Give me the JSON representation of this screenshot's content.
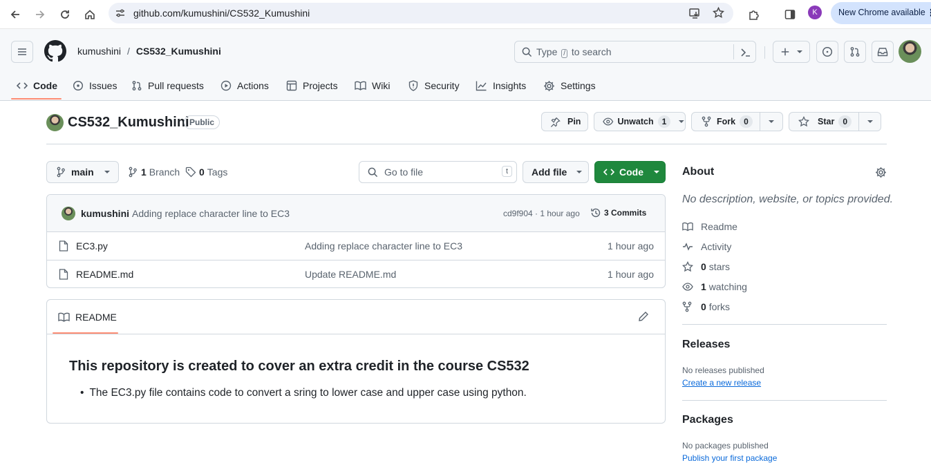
{
  "browser": {
    "url": "github.com/kumushini/CS532_Kumushini",
    "new_chrome_label": "New Chrome available",
    "profile_initial": "K"
  },
  "header": {
    "owner": "kumushini",
    "separator": "/",
    "repo": "CS532_Kumushini",
    "search_prefix": "Type",
    "search_key": "/",
    "search_suffix": "to search"
  },
  "tabs": [
    {
      "label": "Code",
      "icon": "code-icon"
    },
    {
      "label": "Issues",
      "icon": "issue-icon"
    },
    {
      "label": "Pull requests",
      "icon": "pull-request-icon"
    },
    {
      "label": "Actions",
      "icon": "play-icon"
    },
    {
      "label": "Projects",
      "icon": "table-icon"
    },
    {
      "label": "Wiki",
      "icon": "book-icon"
    },
    {
      "label": "Security",
      "icon": "shield-icon"
    },
    {
      "label": "Insights",
      "icon": "graph-icon"
    },
    {
      "label": "Settings",
      "icon": "gear-icon"
    }
  ],
  "repo": {
    "name": "CS532_Kumushini",
    "visibility": "Public",
    "pin_label": "Pin",
    "unwatch_label": "Unwatch",
    "watch_count": "1",
    "fork_label": "Fork",
    "fork_count": "0",
    "star_label": "Star",
    "star_count": "0"
  },
  "toolbar": {
    "branch": "main",
    "branches_count": "1",
    "branches_label": "Branch",
    "tags_count": "0",
    "tags_label": "Tags",
    "goto_placeholder": "Go to file",
    "goto_key": "t",
    "add_file_label": "Add file",
    "code_label": "Code"
  },
  "commit": {
    "author": "kumushini",
    "message": "Adding replace character line to EC3",
    "hash_time": "cd9f904 · 1 hour ago",
    "commits_label": "3 Commits"
  },
  "files": [
    {
      "name": "EC3.py",
      "message": "Adding replace character line to EC3",
      "time": "1 hour ago"
    },
    {
      "name": "README.md",
      "message": "Update README.md",
      "time": "1 hour ago"
    }
  ],
  "readme": {
    "tab_label": "README",
    "heading": "This repository is created to cover an extra credit in the course CS532",
    "bullet": "The EC3.py file contains code to convert a sring to lower case and upper case using python."
  },
  "about": {
    "title": "About",
    "description": "No description, website, or topics provided.",
    "items": [
      {
        "label": "Readme",
        "icon": "book-icon"
      },
      {
        "label": "Activity",
        "icon": "pulse-icon"
      },
      {
        "count": "0",
        "label": "stars",
        "icon": "star-icon"
      },
      {
        "count": "1",
        "label": "watching",
        "icon": "eye-icon"
      },
      {
        "count": "0",
        "label": "forks",
        "icon": "fork-icon"
      }
    ]
  },
  "releases": {
    "title": "Releases",
    "empty": "No releases published",
    "link": "Create a new release"
  },
  "packages": {
    "title": "Packages",
    "empty": "No packages published",
    "link": "Publish your first package"
  },
  "colors": {
    "accent_green": "#1f883d",
    "underline_orange": "#fd8c73",
    "link_blue": "#0969da"
  }
}
